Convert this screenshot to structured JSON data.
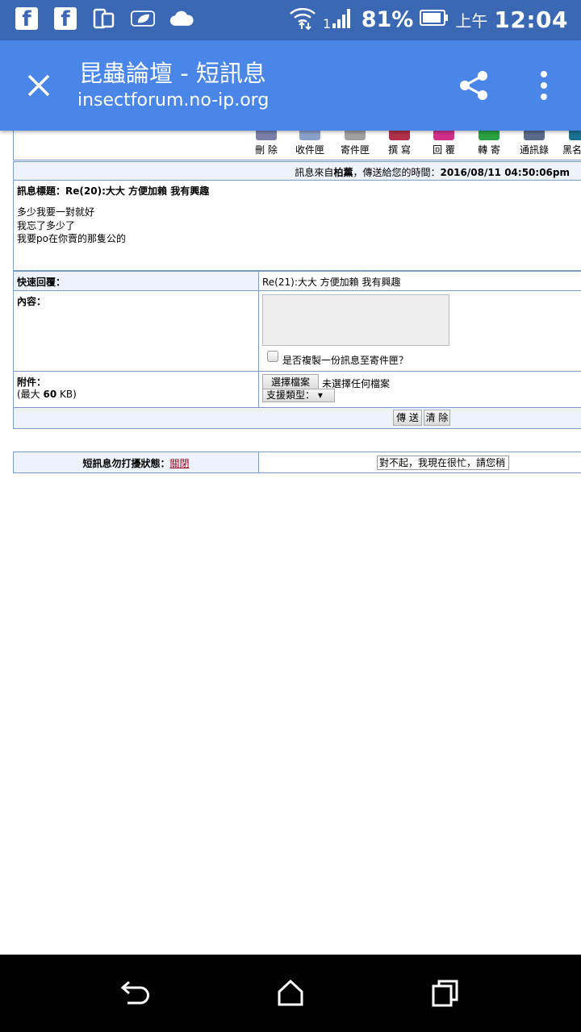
{
  "statusbar": {
    "battery_percent": "81%",
    "ampm": "上午",
    "time": "12:04",
    "icons": [
      "facebook-icon",
      "facebook-icon",
      "phone-tablet-icon",
      "leaf-icon",
      "cloud-icon",
      "wifi-icon",
      "signal-icon",
      "battery-icon"
    ]
  },
  "appbar": {
    "title": "昆蟲論壇 - 短訊息",
    "url": "insectforum.no-ip.org"
  },
  "toolbar": {
    "items": [
      {
        "label": "刪 除",
        "icon": "delete-icon"
      },
      {
        "label": "收件匣",
        "icon": "inbox-icon"
      },
      {
        "label": "寄件匣",
        "icon": "outbox-icon"
      },
      {
        "label": "撰 寫",
        "icon": "compose-icon"
      },
      {
        "label": "回 覆",
        "icon": "reply-icon"
      },
      {
        "label": "轉 寄",
        "icon": "forward-icon"
      },
      {
        "label": "通訊錄",
        "icon": "address-book-icon"
      },
      {
        "label": "黑名",
        "icon": "blacklist-icon"
      }
    ]
  },
  "message": {
    "from_prefix": "訊息來自",
    "sender": "柏薰",
    "sent_prefix": "，傳送給您的時間：",
    "sent_time": "2016/08/11 04:50:06pm",
    "subject_label": "訊息標題：",
    "subject": "Re(20):大大  方便加賴   我有興趣",
    "body_lines": [
      "多少我要一對就好",
      "我忘了多少了",
      "我要po在你賣的那隻公的"
    ]
  },
  "reply": {
    "quick_label": "快速回覆：",
    "quick_subject": "Re(21):大大  方便加賴   我有興趣",
    "content_label": "內容：",
    "content_value": "",
    "copy_label": "是否複製一份訊息至寄件匣？",
    "attach_label": "附件：",
    "attach_max_prefix": "(最大 ",
    "attach_max_value": "60",
    "attach_max_suffix": " KB)",
    "choose_file": "選擇檔案",
    "no_file": "未選擇任何檔案",
    "support_types": "支援類型：",
    "send": "傳 送",
    "clear": "清 除"
  },
  "dnd": {
    "label": "短訊息勿打擾狀態：",
    "state_link": "關閉",
    "input_value": "對不起，我現在很忙，請您稍"
  },
  "colors": {
    "statusbar": "#3a68b4",
    "appbar": "#4a86e8",
    "table_border": "#7a9ccc",
    "light_bg": "#eef3fb",
    "link": "#a0001e"
  }
}
